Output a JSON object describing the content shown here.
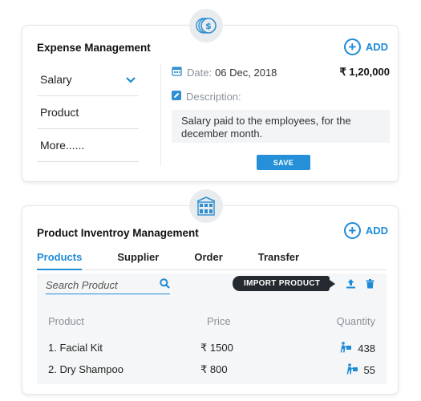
{
  "expense": {
    "title": "Expense Management",
    "add_label": "ADD",
    "categories": [
      {
        "label": "Salary"
      },
      {
        "label": "Product"
      },
      {
        "label": "More......"
      }
    ],
    "date_label": "Date:",
    "date_value": "06 Dec, 2018",
    "amount": "₹ 1,20,000",
    "description_label": "Description:",
    "description_text": "Salary paid to the employees, for the december month.",
    "save_label": "SAVE"
  },
  "inventory": {
    "title": "Product Inventroy Management",
    "add_label": "ADD",
    "tabs": [
      {
        "label": "Products",
        "active": true
      },
      {
        "label": "Supplier"
      },
      {
        "label": "Order"
      },
      {
        "label": "Transfer"
      }
    ],
    "search_placeholder": "Search Product",
    "import_label": "IMPORT PRODUCT",
    "columns": {
      "product": "Product",
      "price": "Price",
      "quantity": "Quantity"
    },
    "rows": [
      {
        "product": "1. Facial Kit",
        "price": "₹ 1500",
        "quantity": "438"
      },
      {
        "product": "2. Dry Shampoo",
        "price": "₹ 800",
        "quantity": "55"
      }
    ]
  },
  "colors": {
    "accent": "#1e8bd6",
    "dark_tag": "#242a30",
    "badge_bg": "#e9ecef"
  }
}
